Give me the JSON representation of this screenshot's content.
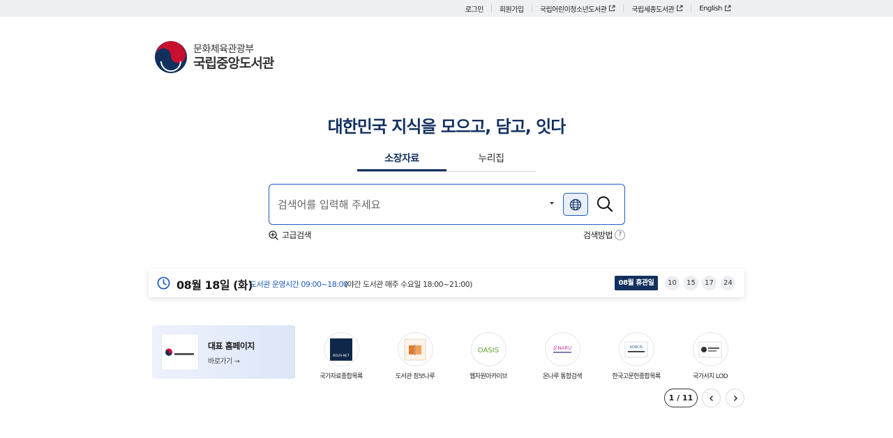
{
  "topbar": {
    "links": [
      {
        "label": "로그인",
        "external": false
      },
      {
        "label": "회원가입",
        "external": false
      },
      {
        "label": "국립어린이청소년도서관",
        "external": true
      },
      {
        "label": "국립세종도서관",
        "external": true
      },
      {
        "label": "English",
        "external": true
      }
    ]
  },
  "logo": {
    "ministry": "문화체육관광부",
    "name": "국립중앙도서관"
  },
  "hero": {
    "title": "대한민국 지식을  모으고, 담고, 잇다",
    "tabs": [
      {
        "label": "소장자료",
        "active": true
      },
      {
        "label": "누리집",
        "active": false
      }
    ]
  },
  "search": {
    "placeholder": "검색어를 입력해 주세요",
    "value": "",
    "advanced_label": "고급검색",
    "howto_label": "검색방법",
    "howto_icon_text": "?"
  },
  "infobar": {
    "date": "08월 18일 (화)",
    "hours": "도서관 운영시간 09:00~18:00",
    "night": "(야간 도서관 매주 수요일 18:00~21:00)",
    "closed_label": "08월 휴관일",
    "closed_days": [
      "10",
      "15",
      "17",
      "24"
    ]
  },
  "quick": {
    "main": {
      "title": "대표 홈페이지",
      "link": "바로가기 →",
      "thumb_text": "국립중앙도서관"
    },
    "items": [
      {
        "label": "국가자료종합목록",
        "icon": "kolis-net-icon",
        "icon_text": "KOLIS-NET"
      },
      {
        "label": "도서관 정보나루",
        "icon": "book-icon",
        "icon_text": ""
      },
      {
        "label": "웹자원아카이브",
        "icon": "oasis-icon",
        "icon_text": "OASIS"
      },
      {
        "label": "온나루 통합검색",
        "icon": "onnaru-icon",
        "icon_text": "온NARU"
      },
      {
        "label": "한국고문헌종합목록",
        "icon": "korci-icon",
        "icon_text": "KORCIS"
      },
      {
        "label": "국가서지 LOD",
        "icon": "lod-icon",
        "icon_text": ""
      }
    ],
    "pager": "1 / 11"
  },
  "colors": {
    "brand": "#12305e",
    "accent": "#1d5bbf",
    "red": "#c8102e"
  }
}
